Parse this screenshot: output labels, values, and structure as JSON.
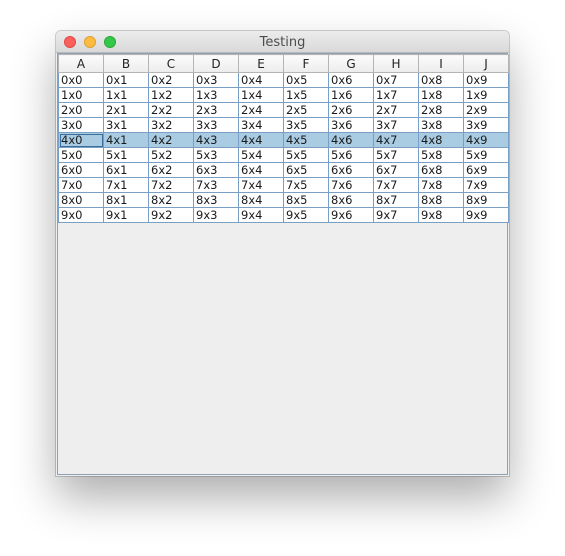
{
  "window": {
    "title": "Testing"
  },
  "table": {
    "columns": [
      "A",
      "B",
      "C",
      "D",
      "E",
      "F",
      "G",
      "H",
      "I",
      "J"
    ],
    "selected_row_index": 4,
    "rows": [
      [
        "0x0",
        "0x1",
        "0x2",
        "0x3",
        "0x4",
        "0x5",
        "0x6",
        "0x7",
        "0x8",
        "0x9"
      ],
      [
        "1x0",
        "1x1",
        "1x2",
        "1x3",
        "1x4",
        "1x5",
        "1x6",
        "1x7",
        "1x8",
        "1x9"
      ],
      [
        "2x0",
        "2x1",
        "2x2",
        "2x3",
        "2x4",
        "2x5",
        "2x6",
        "2x7",
        "2x8",
        "2x9"
      ],
      [
        "3x0",
        "3x1",
        "3x2",
        "3x3",
        "3x4",
        "3x5",
        "3x6",
        "3x7",
        "3x8",
        "3x9"
      ],
      [
        "4x0",
        "4x1",
        "4x2",
        "4x3",
        "4x4",
        "4x5",
        "4x6",
        "4x7",
        "4x8",
        "4x9"
      ],
      [
        "5x0",
        "5x1",
        "5x2",
        "5x3",
        "5x4",
        "5x5",
        "5x6",
        "5x7",
        "5x8",
        "5x9"
      ],
      [
        "6x0",
        "6x1",
        "6x2",
        "6x3",
        "6x4",
        "6x5",
        "6x6",
        "6x7",
        "6x8",
        "6x9"
      ],
      [
        "7x0",
        "7x1",
        "7x2",
        "7x3",
        "7x4",
        "7x5",
        "7x6",
        "7x7",
        "7x8",
        "7x9"
      ],
      [
        "8x0",
        "8x1",
        "8x2",
        "8x3",
        "8x4",
        "8x5",
        "8x6",
        "8x7",
        "8x8",
        "8x9"
      ],
      [
        "9x0",
        "9x1",
        "9x2",
        "9x3",
        "9x4",
        "9x5",
        "9x6",
        "9x7",
        "9x8",
        "9x9"
      ]
    ]
  },
  "colors": {
    "selection": "#a9cce3",
    "close": "#fc605c",
    "minimize": "#fdbc40",
    "maximize": "#34c84a"
  }
}
